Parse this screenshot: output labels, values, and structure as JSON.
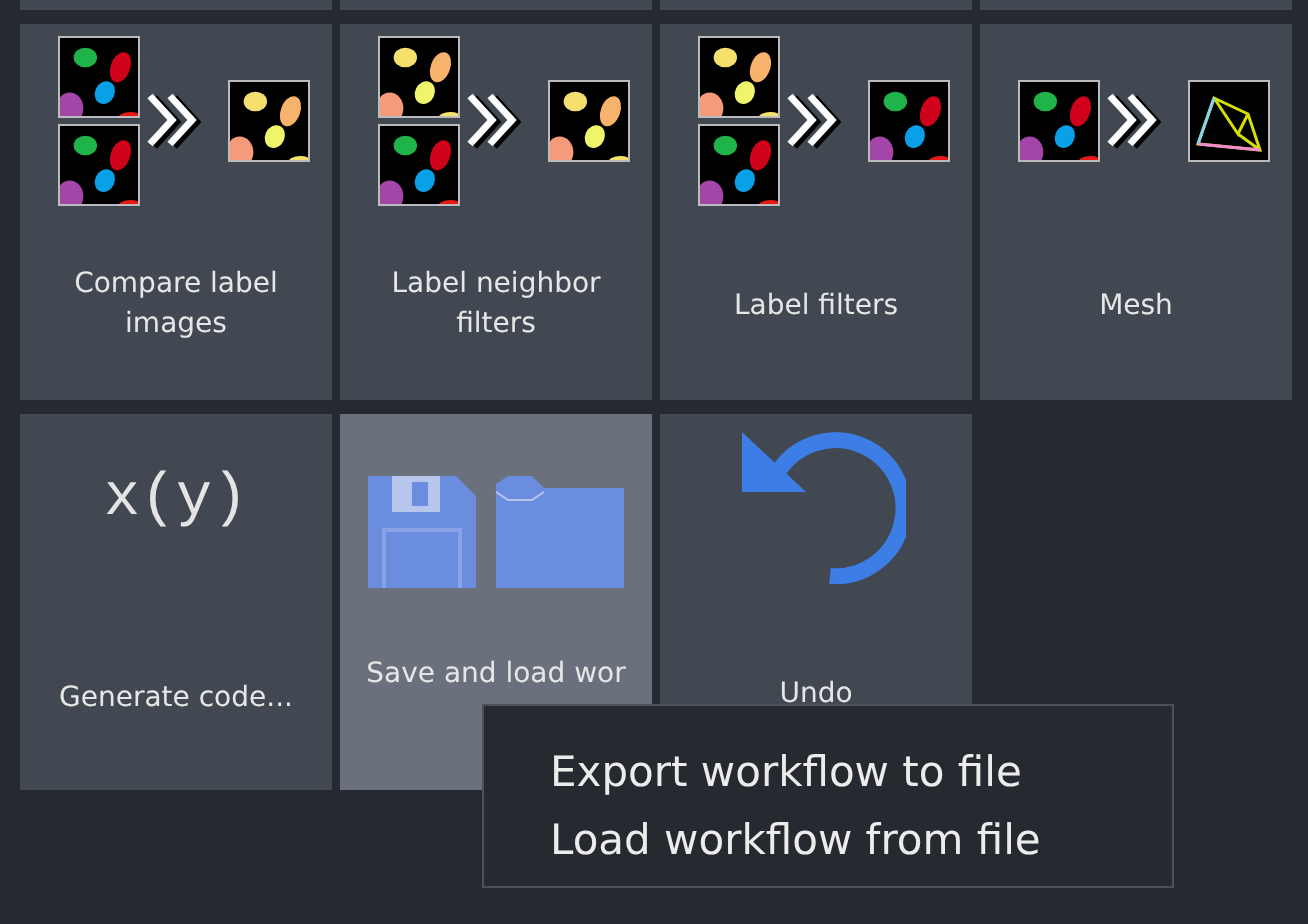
{
  "tiles": [
    {
      "label": "Compare label images",
      "kind": "compare",
      "hovered": false
    },
    {
      "label": "Label neighbor filters",
      "kind": "neighbor",
      "hovered": false
    },
    {
      "label": "Label filters",
      "kind": "filter",
      "hovered": false
    },
    {
      "label": "Mesh",
      "kind": "mesh",
      "hovered": false
    },
    {
      "label": "Generate code...",
      "kind": "code",
      "icon_text": "x(y)",
      "hovered": false
    },
    {
      "label": "Save and load wor",
      "kind": "saveload",
      "hovered": true
    },
    {
      "label": "Undo",
      "kind": "undo",
      "hovered": false
    }
  ],
  "context_menu": {
    "items": [
      "Export workflow to file",
      "Load workflow from file"
    ]
  }
}
